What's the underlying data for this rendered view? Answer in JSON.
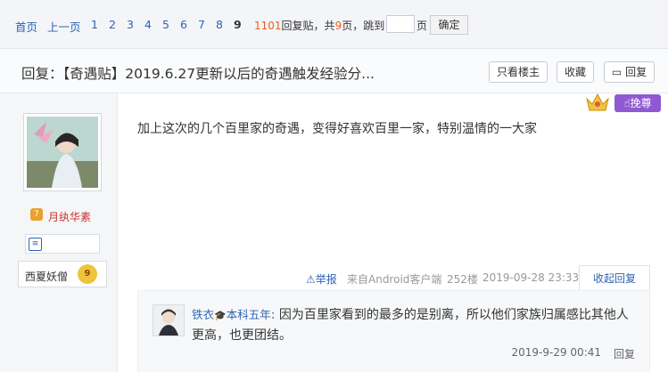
{
  "pager": {
    "first": "首页",
    "prev": "上一页",
    "pages": [
      "1",
      "2",
      "3",
      "4",
      "5",
      "6",
      "7",
      "8",
      "9"
    ],
    "current": "9",
    "reply_count": "1101",
    "reply_label": "回复贴，共",
    "page_total": "9",
    "page_suffix": "页，跳到",
    "page_unit": "页",
    "go_button": "确定"
  },
  "thread": {
    "title": "回复：【奇遇贴】2019.6.27更新以后的奇遇触发经验分...",
    "only_author": "只看楼主",
    "favorite": "收藏",
    "reply": "回复"
  },
  "post": {
    "username": "月纨华素",
    "badge_name": "西夏妖僧",
    "badge_level": "9",
    "boost_label": "挽尊",
    "content": "加上这次的几个百里家的奇遇，变得好喜欢百里一家，特别温情的一大家",
    "report": "举报",
    "source": "来自Android客户端",
    "floor": "252楼",
    "time": "2019-09-28 23:33",
    "collapse": "收起回复"
  },
  "sub_reply": {
    "user": "铁衣",
    "user_tag": "本科五年",
    "text": "因为百里家看到的最多的是别离，所以他们家族归属感比其他人更高，也更团结。",
    "time": "2019-9-29 00:41",
    "reply": "回复"
  },
  "colors": {
    "link": "#2d64b3",
    "red": "#e6601c",
    "purple": "#8f5ad1"
  }
}
